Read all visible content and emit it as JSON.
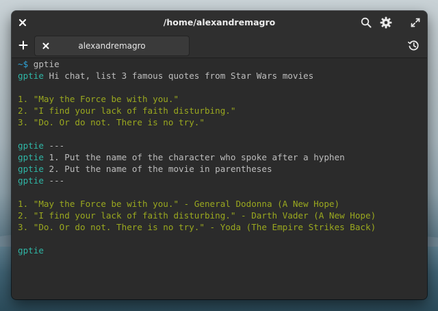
{
  "window": {
    "title": "/home/alexandremagro"
  },
  "tab": {
    "label": "alexandremagro"
  },
  "icons": {
    "close": "close-icon",
    "search": "search-icon",
    "settings": "gear-icon",
    "maximize": "maximize-icon",
    "new_tab": "plus-icon",
    "tab_close": "close-icon",
    "history": "history-icon"
  },
  "colors": {
    "prompt": "#2fa3d6",
    "command": "#2fb5a5",
    "output": "#9aa81f",
    "text": "#bdbdbd",
    "background": "#2b2b2b"
  },
  "terminal": {
    "prompt": "~$ ",
    "first_command": "gptie",
    "cmd": "gptie",
    "q1": " Hi chat, list 3 famous quotes from Star Wars movies",
    "a1": "1. \"May the Force be with you.\"",
    "a2": "2. \"I find your lack of faith disturbing.\"",
    "a3": "3. \"Do. Or do not. There is no try.\"",
    "sep1": " ---",
    "inst1": " 1. Put the name of the character who spoke after a hyphen",
    "inst2": " 2. Put the name of the movie in parentheses",
    "sep2": " ---",
    "b1": "1. \"May the Force be with you.\" - General Dodonna (A New Hope)",
    "b2": "2. \"I find your lack of faith disturbing.\" - Darth Vader (A New Hope)",
    "b3": "3. \"Do. Or do not. There is no try.\" - Yoda (The Empire Strikes Back)"
  }
}
